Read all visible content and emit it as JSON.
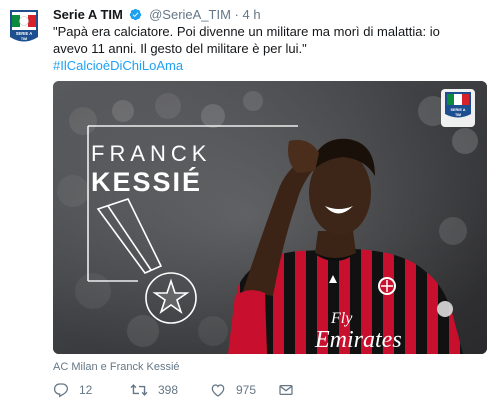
{
  "tweet": {
    "author": {
      "display_name": "Serie A TIM",
      "handle": "@SerieA_TIM",
      "verified": true,
      "avatar_logo": {
        "line1": "SERIE A",
        "line2": "TIM"
      }
    },
    "separator": "·",
    "time": "4 h",
    "text": "\"Papà era calciatore. Poi divenne un militare ma morì di malattia: io avevo 11 anni. Il gesto del militare è per lui.\"",
    "hashtag": "#IlCalcioèDiChiLoAma",
    "media": {
      "name_first": "FRANCK",
      "name_last": "KESSIÉ",
      "sponsor_line1": "Fly",
      "sponsor_line2": "Emirates",
      "badge_logo": {
        "line1": "SERIE A",
        "line2": "TIM"
      }
    },
    "tagged_users": "AC Milan e Franck Kessié",
    "stats": {
      "replies": "12",
      "retweets": "398",
      "likes": "975"
    },
    "colors": {
      "link": "#1da1f2",
      "muted": "#657786",
      "text": "#14171a",
      "milan_red": "#c8102e"
    },
    "icons": {
      "reply": "speech-bubble-icon",
      "retweet": "retweet-arrows-icon",
      "like": "heart-icon",
      "dm": "envelope-icon",
      "verified": "verified-check-icon"
    }
  }
}
